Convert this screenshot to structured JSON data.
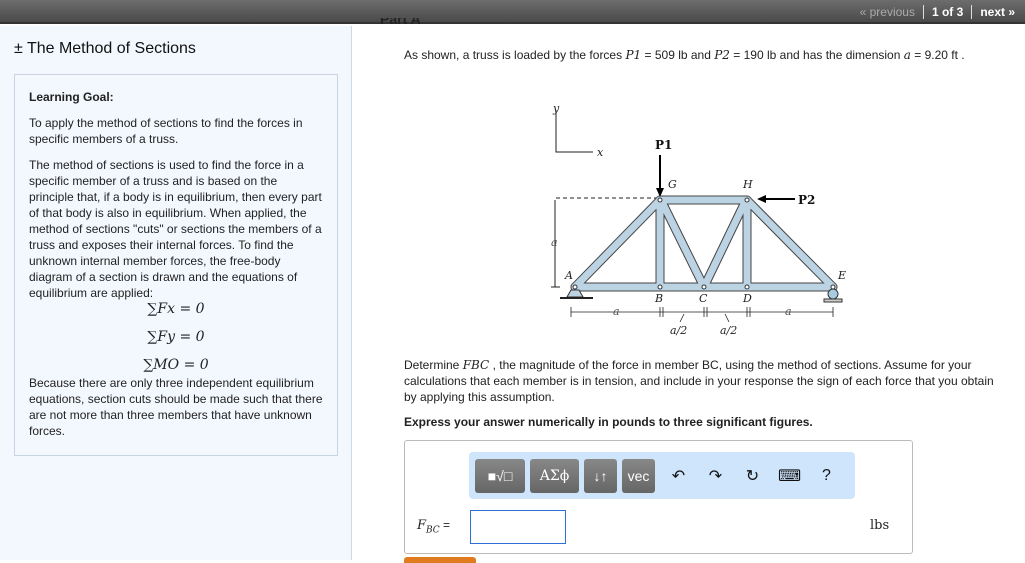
{
  "nav": {
    "previous": "« previous",
    "page": "1 of 3",
    "next": "next »"
  },
  "left": {
    "title": "± The Method of Sections",
    "goal_heading": "Learning Goal:",
    "goal_text": "To apply the method of sections to find the forces in specific members of a truss.",
    "para1": "The method of sections is used to find the force in a specific member of a truss and is based on the principle that, if a body is in equilibrium, then every part of that body is also in equilibrium. When applied, the method of sections \"cuts\" or sections the members of a truss and exposes their internal forces. To find the unknown internal member forces, the free-body diagram of a section is drawn and the equations of equilibrium are applied:",
    "eq1": "∑Fx = 0",
    "eq2": "∑Fy = 0",
    "eq3": "∑MO = 0",
    "para2": "Because there are only three independent equilibrium equations, section cuts should be made such that there are not more than three members that have unknown forces."
  },
  "part": "Part A",
  "intro": {
    "t1": "As shown, a truss is loaded by the forces ",
    "p1": "P1",
    "t2": " = 509 lb and ",
    "p2": "P2",
    "t3": " = 190 lb and has the dimension ",
    "a": "a",
    "t4": " = 9.20 ft ."
  },
  "figure": {
    "y": "y",
    "x": "x",
    "P1": "P1",
    "P2": "P2",
    "G": "G",
    "H": "H",
    "A": "A",
    "B": "B",
    "C": "C",
    "D": "D",
    "E": "E",
    "a": "a",
    "a2": "a/2"
  },
  "question": {
    "t1": "Determine ",
    "f": "FBC",
    "t2": " , the magnitude of the force in member BC, using the method of sections. Assume for your calculations that each member is in tension, and include in your response the sign of each force that you obtain by applying this assumption."
  },
  "express": "Express your answer numerically in pounds to three significant figures.",
  "toolbar": {
    "templates": "■√□",
    "greek": "ΑΣϕ",
    "arrows": "↓↑",
    "vec": "vec",
    "undo": "↶",
    "redo": "↷",
    "reset": "↻",
    "keyboard": "⌨",
    "help": "?"
  },
  "answer": {
    "label": "F",
    "sub": "BC",
    "eq": " =",
    "value": "",
    "unit": "lbs"
  }
}
